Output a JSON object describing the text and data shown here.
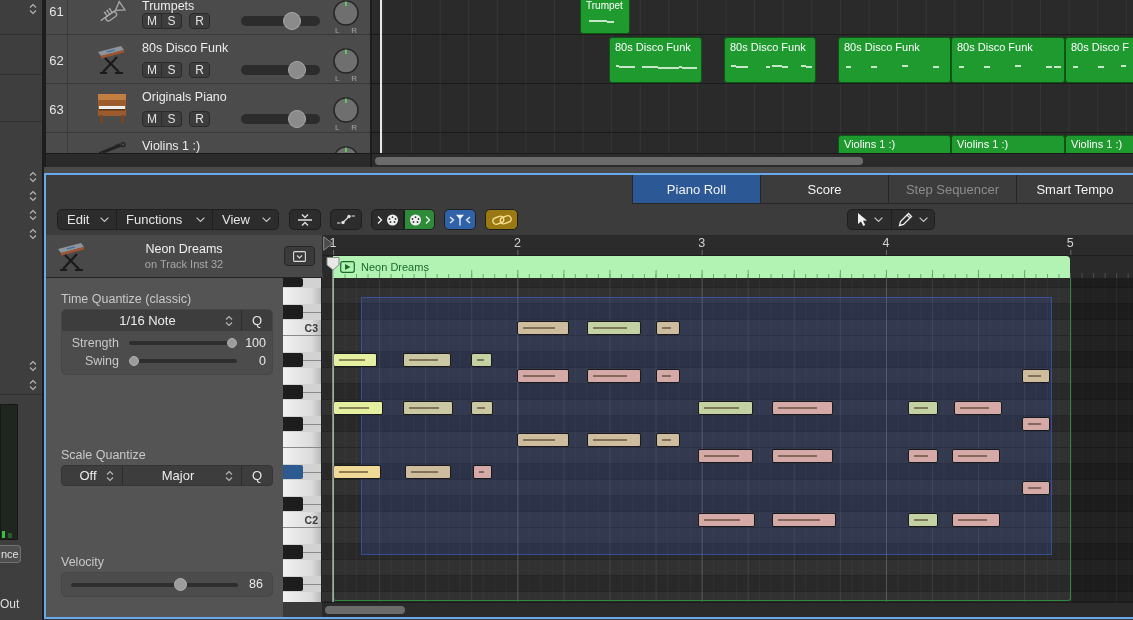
{
  "side_panel": {
    "button": "nce",
    "label": "Out"
  },
  "tracks": [
    {
      "number": "61",
      "name": "Trumpets",
      "buttons": [
        {
          "label": "M",
          "on": false
        },
        {
          "label": "S",
          "on": false
        },
        {
          "label": "R",
          "on": false
        }
      ],
      "level": 0.69,
      "pan_labels": [
        "L",
        "R"
      ],
      "regions": [
        {
          "name": "Trumpet"
        }
      ]
    },
    {
      "number": "62",
      "name": "80s Disco Funk",
      "buttons": [
        {
          "label": "M",
          "on": false
        },
        {
          "label": "S",
          "on": false
        },
        {
          "label": "R",
          "on": false
        }
      ],
      "level": 0.77,
      "pan_labels": [
        "L",
        "R"
      ],
      "regions": [
        {
          "name": "80s Disco Funk"
        },
        {
          "name": "80s Disco Funk"
        },
        {
          "name": "80s Disco Funk"
        },
        {
          "name": "80s Disco Funk"
        },
        {
          "name": "80s Disco F"
        }
      ]
    },
    {
      "number": "63",
      "name": "Originals Piano",
      "buttons": [
        {
          "label": "M",
          "on": false
        },
        {
          "label": "S",
          "on": false
        },
        {
          "label": "R",
          "on": false
        }
      ],
      "level": 0.77,
      "pan_labels": [
        "L",
        "R"
      ]
    },
    {
      "name": "Violins 1 :)",
      "regions": [
        {
          "name": "Violins 1 :)"
        },
        {
          "name": "Violins 1 :)"
        },
        {
          "name": "Violins 1 :)"
        }
      ]
    }
  ],
  "editor": {
    "tabs": [
      {
        "label": "Piano Roll",
        "selected": true,
        "disabled": false
      },
      {
        "label": "Score",
        "selected": false,
        "disabled": false
      },
      {
        "label": "Step Sequencer",
        "selected": false,
        "disabled": true
      },
      {
        "label": "Smart Tempo",
        "selected": false,
        "disabled": false
      }
    ],
    "menus": [
      "Edit",
      "Functions",
      "View"
    ],
    "toolbar_buttons": [
      {
        "kind": "collapse",
        "on": false
      },
      {
        "kind": "curve",
        "on": false
      },
      {
        "kind": "midi-in",
        "on": false
      },
      {
        "kind": "midi-out",
        "on": true
      },
      {
        "kind": "catch",
        "on": true
      },
      {
        "kind": "link",
        "on": true
      }
    ],
    "inspector": {
      "region": "Neon Dreams",
      "track": "on Track Inst 32",
      "time_quantize": {
        "title": "Time Quantize (classic)",
        "value": "1/16 Note",
        "button": "Q",
        "strength": {
          "label": "Strength",
          "level": 1,
          "reading": "100"
        },
        "swing": {
          "label": "Swing",
          "level": 0,
          "reading": "0"
        }
      },
      "scale_quantize": {
        "title": "Scale Quantize",
        "root": "Off",
        "scale": "Major",
        "button": "Q"
      },
      "velocity": {
        "title": "Velocity",
        "level": 0.67,
        "reading": "86"
      }
    },
    "piano_roll": {
      "region_name": "Neon Dreams",
      "keyboard": [
        {
          "kind": "black",
          "selected": false
        },
        {
          "kind": "white",
          "selected": false
        },
        {
          "kind": "black",
          "selected": false
        },
        {
          "kind": "white",
          "selected": false
        },
        {
          "kind": "white",
          "selected": false
        },
        {
          "kind": "black",
          "selected": false
        },
        {
          "kind": "white",
          "selected": false
        },
        {
          "kind": "black",
          "selected": false
        },
        {
          "kind": "white",
          "selected": false
        },
        {
          "kind": "black",
          "selected": false
        },
        {
          "kind": "white",
          "selected": false
        },
        {
          "kind": "white",
          "selected": false
        },
        {
          "kind": "black",
          "selected": true
        },
        {
          "kind": "white",
          "selected": false
        },
        {
          "kind": "black",
          "selected": false
        },
        {
          "kind": "white",
          "selected": false
        },
        {
          "kind": "white",
          "selected": false
        },
        {
          "kind": "black",
          "selected": false
        },
        {
          "kind": "white",
          "selected": false
        },
        {
          "kind": "black",
          "selected": false
        },
        {
          "kind": "white",
          "selected": false
        }
      ],
      "chart_data": {
        "type": "bar",
        "orientation": "horizontal",
        "categories": [
          null,
          null,
          null,
          "C3",
          null,
          null,
          null,
          null,
          null,
          null,
          null,
          null,
          null,
          null,
          null,
          "C2",
          null,
          null,
          null,
          null,
          null
        ],
        "xticks": [
          1,
          2,
          3,
          4,
          5
        ],
        "xlim": [
          0.94,
          5.34
        ],
        "ref_lines": [
          {
            "axis": "x",
            "value": 1,
            "color": "#e8e8e8"
          }
        ],
        "bands": [
          {
            "axis": "x",
            "from": 1.15,
            "to": 4.9,
            "color": "#3a60c8"
          }
        ],
        "series": [
          {
            "base": [
              null,
              null,
              null,
              2.0,
              null,
              1.0,
              2.0,
              null,
              1.0,
              4.74,
              2.0,
              2.98,
              1.0,
              4.74,
              null,
              2.98,
              null,
              null,
              null,
              null,
              null
            ],
            "values": [
              null,
              null,
              null,
              0.28,
              null,
              0.24,
              0.28,
              null,
              0.27,
              0.15,
              0.28,
              0.3,
              0.26,
              0.15,
              null,
              0.31,
              null,
              null,
              null,
              null,
              null
            ],
            "colors": [
              null,
              null,
              null,
              "#cdbc9e",
              null,
              "#e4ef9f",
              "#d4a9a7",
              null,
              "#e4ef9f",
              "#d4a9a7",
              "#cdbc9e",
              "#d4a9a7",
              "#efd996",
              "#d4a9a7",
              null,
              "#d4a9a7",
              null,
              null,
              null,
              null,
              null
            ]
          },
          {
            "base": [
              null,
              null,
              null,
              2.38,
              null,
              1.38,
              2.38,
              null,
              1.38,
              null,
              2.38,
              3.38,
              1.39,
              null,
              null,
              3.38,
              null,
              null,
              null,
              null,
              null
            ],
            "values": [
              null,
              null,
              null,
              0.29,
              null,
              0.26,
              0.29,
              null,
              0.27,
              null,
              0.29,
              0.33,
              0.25,
              null,
              null,
              0.35,
              null,
              null,
              null,
              null,
              null
            ],
            "colors": [
              null,
              null,
              null,
              "#c4d1a3",
              null,
              "#c9c8a0",
              "#d4a9a7",
              null,
              "#c9c8a0",
              null,
              "#cdbc9e",
              "#d4a9a7",
              "#cdbc9e",
              null,
              null,
              "#d4a9a7",
              null,
              null,
              null,
              null,
              null
            ]
          },
          {
            "base": [
              null,
              null,
              null,
              2.75,
              null,
              1.75,
              2.75,
              null,
              1.75,
              null,
              2.75,
              4.12,
              1.76,
              null,
              null,
              4.12,
              null,
              null,
              null,
              null,
              null
            ],
            "values": [
              null,
              null,
              null,
              0.13,
              null,
              0.11,
              0.13,
              null,
              0.12,
              null,
              0.13,
              0.16,
              0.1,
              null,
              null,
              0.16,
              null,
              null,
              null,
              null,
              null
            ],
            "colors": [
              null,
              null,
              null,
              "#cdbc9e",
              null,
              "#c4d1a3",
              "#d4a9a7",
              null,
              "#c9c8a0",
              null,
              "#cdbc9e",
              "#d4a9a7",
              "#d4a9a7",
              null,
              null,
              "#c4d1a3",
              null,
              null,
              null,
              null,
              null
            ]
          },
          {
            "base": [
              null,
              null,
              null,
              null,
              null,
              null,
              4.74,
              null,
              2.98,
              null,
              null,
              4.36,
              null,
              null,
              null,
              4.36,
              null,
              null,
              null,
              null,
              null
            ],
            "values": [
              null,
              null,
              null,
              null,
              null,
              null,
              0.15,
              null,
              0.3,
              null,
              null,
              0.26,
              null,
              null,
              null,
              0.26,
              null,
              null,
              null,
              null,
              null
            ],
            "colors": [
              null,
              null,
              null,
              null,
              null,
              null,
              "#cdbc9e",
              null,
              "#c4d1a3",
              null,
              null,
              "#d4a9a7",
              null,
              null,
              null,
              "#d4a9a7",
              null,
              null,
              null,
              null,
              null
            ]
          },
          {
            "base": [
              null,
              null,
              null,
              null,
              null,
              null,
              null,
              null,
              3.38,
              null,
              null,
              null,
              null,
              null,
              null,
              null,
              null,
              null,
              null,
              null,
              null
            ],
            "values": [
              null,
              null,
              null,
              null,
              null,
              null,
              null,
              null,
              0.33,
              null,
              null,
              null,
              null,
              null,
              null,
              null,
              null,
              null,
              null,
              null,
              null
            ],
            "colors": [
              null,
              null,
              null,
              null,
              null,
              null,
              null,
              null,
              "#d4a9a7",
              null,
              null,
              null,
              null,
              null,
              null,
              null,
              null,
              null,
              null,
              null,
              null
            ]
          },
          {
            "base": [
              null,
              null,
              null,
              null,
              null,
              null,
              null,
              null,
              4.12,
              null,
              null,
              null,
              null,
              null,
              null,
              null,
              null,
              null,
              null,
              null,
              null
            ],
            "values": [
              null,
              null,
              null,
              null,
              null,
              null,
              null,
              null,
              0.16,
              null,
              null,
              null,
              null,
              null,
              null,
              null,
              null,
              null,
              null,
              null,
              null
            ],
            "colors": [
              null,
              null,
              null,
              null,
              null,
              null,
              null,
              null,
              "#c4d1a3",
              null,
              null,
              null,
              null,
              null,
              null,
              null,
              null,
              null,
              null,
              null,
              null
            ]
          },
          {
            "base": [
              null,
              null,
              null,
              null,
              null,
              null,
              null,
              null,
              4.37,
              null,
              null,
              null,
              null,
              null,
              null,
              null,
              null,
              null,
              null,
              null,
              null
            ],
            "values": [
              null,
              null,
              null,
              null,
              null,
              null,
              null,
              null,
              0.26,
              null,
              null,
              null,
              null,
              null,
              null,
              null,
              null,
              null,
              null,
              null,
              null
            ],
            "colors": [
              null,
              null,
              null,
              null,
              null,
              null,
              null,
              null,
              "#d4a9a7",
              null,
              null,
              null,
              null,
              null,
              null,
              null,
              null,
              null,
              null,
              null,
              null
            ]
          }
        ]
      }
    }
  }
}
